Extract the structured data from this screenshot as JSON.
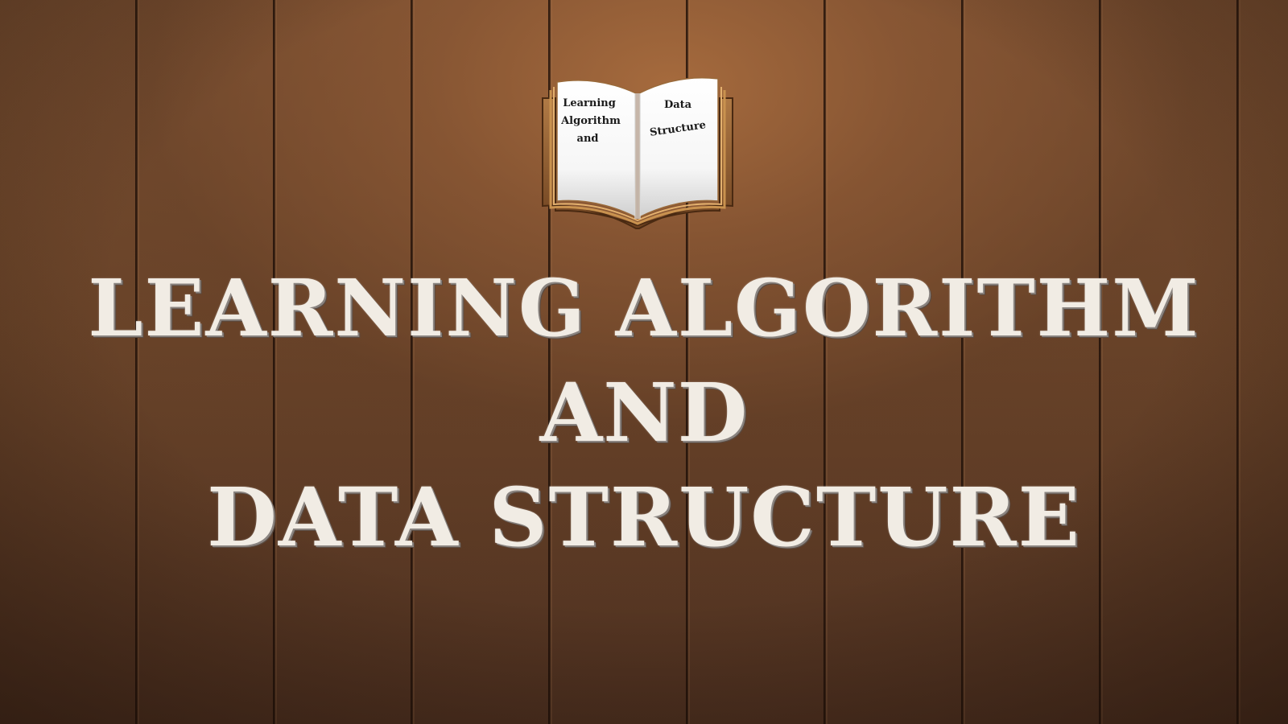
{
  "book_icon": {
    "left_page_lines": [
      "Learning",
      "Algorithm",
      "and"
    ],
    "right_page_lines": [
      "Data",
      "Structure"
    ]
  },
  "title": {
    "line1": "LEARNING ALGORITHM",
    "line2": "AND",
    "line3": "DATA STRUCTURE"
  },
  "colors": {
    "wood_light": "#a86c3e",
    "wood_dark": "#3e2718",
    "title_text": "#f1ece4",
    "book_cover": "#8b5a2b",
    "book_page": "#ffffff"
  }
}
